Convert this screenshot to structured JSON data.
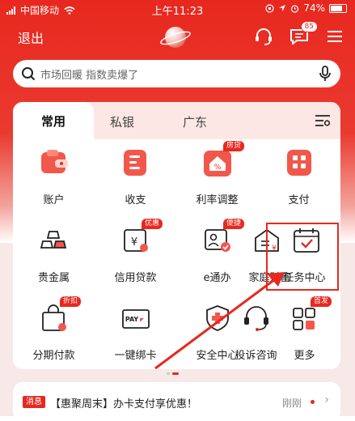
{
  "status": {
    "carrier": "中国移动",
    "time": "上午11:23",
    "battery": "74%"
  },
  "header": {
    "exit_label": "退出",
    "message_badge": "85"
  },
  "search": {
    "placeholder": "市场回暖 指数卖爆了"
  },
  "tabs": [
    {
      "label": "常用"
    },
    {
      "label": "私银"
    },
    {
      "label": "广东"
    }
  ],
  "grid": {
    "row1": [
      {
        "label": "账户"
      },
      {
        "label": "收支"
      },
      {
        "label": "利率调整",
        "tag": "房贷"
      },
      {
        "label": "支付"
      }
    ],
    "row2": [
      {
        "label": "贵金属"
      },
      {
        "label": "信用贷款",
        "tag": "优惠"
      },
      {
        "label": "e通办",
        "tag": "便捷"
      },
      {
        "label": "家庭财富"
      },
      {
        "label": "任务中心"
      }
    ],
    "row3": [
      {
        "label": "分期付款",
        "tag": "折扣"
      },
      {
        "label": "一键绑卡"
      },
      {
        "label": "安全中心"
      },
      {
        "label": "投诉咨询"
      },
      {
        "label": "更多",
        "tag": "首发"
      }
    ]
  },
  "notice": {
    "tag": "消息",
    "text": "【惠聚周末】办卡支付享优惠！",
    "time": "刚刚"
  },
  "colors": {
    "accent": "#e8281f",
    "tab_bar": "#fde7e5"
  }
}
